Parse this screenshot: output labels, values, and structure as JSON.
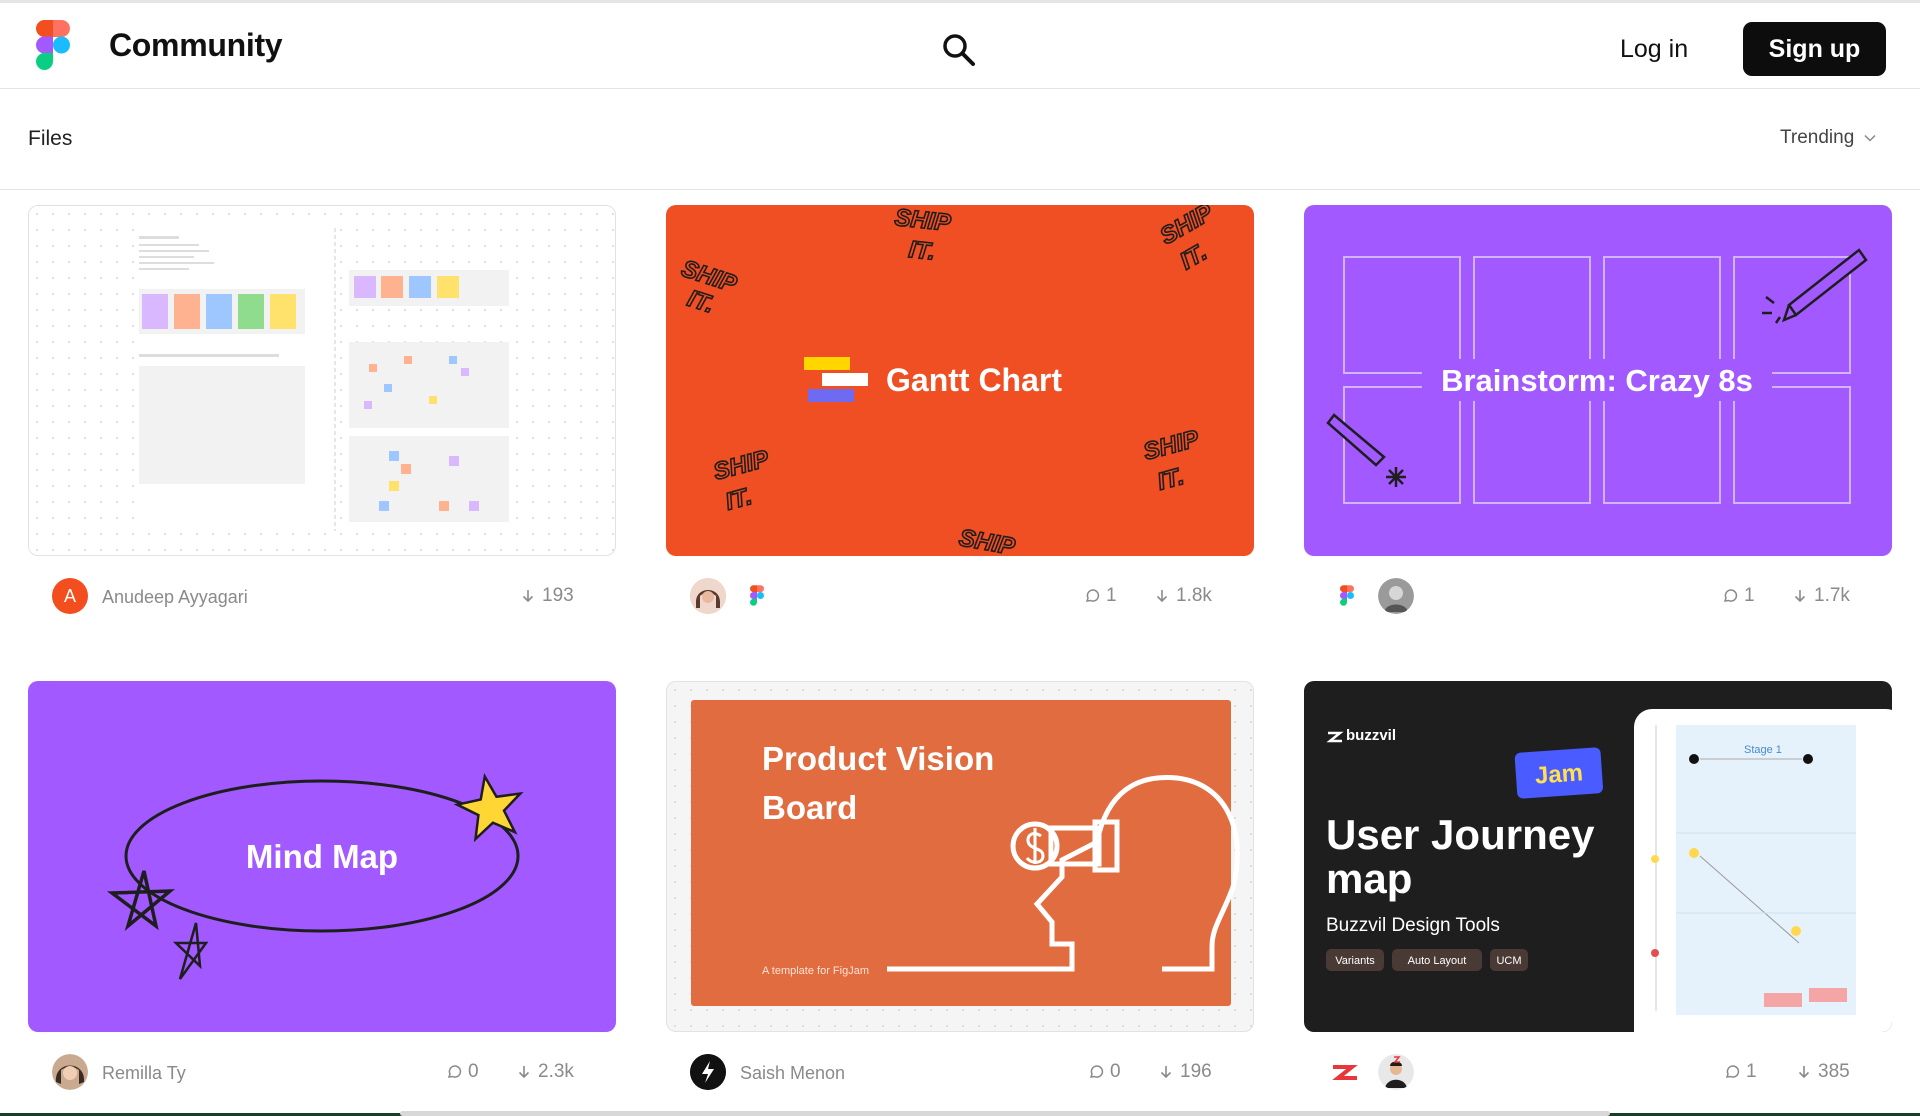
{
  "header": {
    "brand": "Community",
    "login_label": "Log in",
    "signup_label": "Sign up"
  },
  "subbar": {
    "section_label": "Files",
    "sort_label": "Trending"
  },
  "cards": [
    {
      "thumb_title": "",
      "author": "Anudeep Ayyagari",
      "avatar_letter": "A",
      "downloads": "193"
    },
    {
      "thumb_title": "Gantt Chart",
      "doodle_text": [
        "SHIP",
        "IT."
      ],
      "comments": "1",
      "downloads": "1.8k"
    },
    {
      "thumb_title": "Brainstorm: Crazy 8s",
      "comments": "1",
      "downloads": "1.7k"
    },
    {
      "thumb_title": "Mind Map",
      "author": "Remilla Ty",
      "comments": "0",
      "downloads": "2.3k"
    },
    {
      "thumb_title_line1": "Product Vision",
      "thumb_title_line2": "Board",
      "thumb_caption": "A template for FigJam",
      "author": "Saish Menon",
      "comments": "0",
      "downloads": "196"
    },
    {
      "brand_tag": "buzzvil",
      "badge": "Jam",
      "thumb_title_line1": "User Journey",
      "thumb_title_line2": "map",
      "subtitle": "Buzzvil Design Tools",
      "chips": [
        "Variants",
        "Auto Layout",
        "UCM"
      ],
      "stage_label": "Stage 1",
      "comments": "1",
      "downloads": "385"
    }
  ],
  "colors": {
    "orange": "#f04e23",
    "purple": "#a259ff",
    "product_orange": "#e06c3f",
    "dark": "#1e1e1e"
  }
}
